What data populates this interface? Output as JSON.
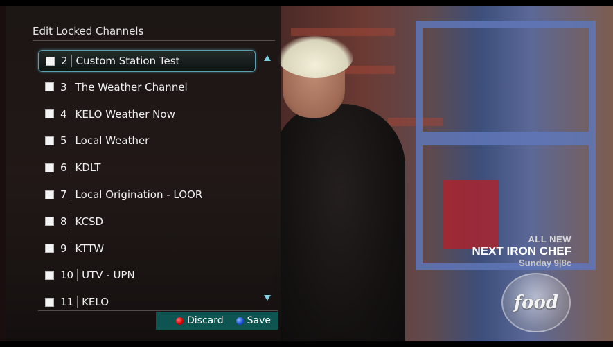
{
  "menu": {
    "title": "Edit Locked Channels",
    "channels": [
      {
        "number": "2",
        "name": "Custom Station Test",
        "checked": false
      },
      {
        "number": "3",
        "name": "The Weather Channel",
        "checked": false
      },
      {
        "number": "4",
        "name": "KELO Weather Now",
        "checked": false
      },
      {
        "number": "5",
        "name": "Local Weather",
        "checked": false
      },
      {
        "number": "6",
        "name": "KDLT",
        "checked": false
      },
      {
        "number": "7",
        "name": "Local Origination - LOOR",
        "checked": false
      },
      {
        "number": "8",
        "name": "KCSD",
        "checked": false
      },
      {
        "number": "9",
        "name": "KTTW",
        "checked": false
      },
      {
        "number": "10",
        "name": "UTV - UPN",
        "checked": false
      },
      {
        "number": "11",
        "name": "KELO",
        "checked": false
      }
    ],
    "selected_index": 0,
    "scroll_up_icon": "triangle-up-icon",
    "scroll_down_icon": "triangle-down-icon"
  },
  "footer": {
    "discard_label": "Discard",
    "discard_color": "#d10000",
    "save_label": "Save",
    "save_color": "#1d4fd8"
  },
  "promo": {
    "line1": "ALL NEW",
    "line2": "NEXT IRON CHEF",
    "line3": "Sunday 9|8c",
    "logo_text": "food"
  },
  "colors": {
    "accent": "#7ed0e0",
    "footer_bg": "#0e5450"
  }
}
